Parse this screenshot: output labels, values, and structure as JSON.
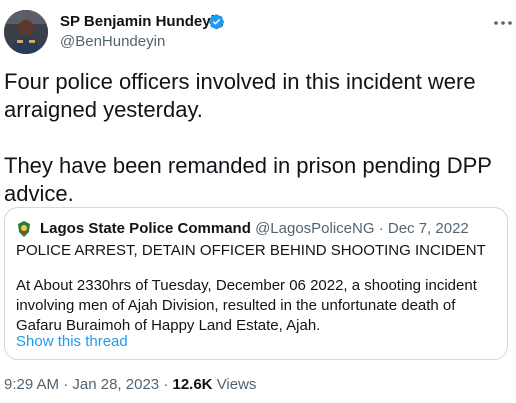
{
  "author": {
    "name": "SP Benjamin Hundeyin",
    "handle": "@BenHundeyin",
    "verified": true,
    "verified_color": "#1d9bf0"
  },
  "tweet": {
    "paragraph1": "Four police officers involved in this incident were arraigned yesterday.",
    "paragraph2": "They have been remanded in prison pending DPP advice."
  },
  "quoted": {
    "name": "Lagos State Police Command",
    "handle": "@LagosPoliceNG",
    "separator": "·",
    "date": "Dec 7, 2022",
    "title": "POLICE ARREST, DETAIN OFFICER BEHIND SHOOTING INCIDENT",
    "body": "At About 2330hrs of Tuesday, December 06 2022, a shooting incident involving men of Ajah Division, resulted in the unfortunate death of Gafaru Buraimoh of Happy Land Estate, Ajah.",
    "show_thread": "Show this thread"
  },
  "meta": {
    "time": "9:29 AM",
    "dot": "·",
    "date": "Jan 28, 2023",
    "views_count": "12.6K",
    "views_label": "Views"
  },
  "colors": {
    "text_primary": "#0f1419",
    "text_secondary": "#536471",
    "link": "#1d9bf0",
    "border": "#cfd9de"
  },
  "icons": {
    "verified": "verified-badge-icon",
    "more": "more-options-icon",
    "quoted_avatar": "police-emblem-icon"
  }
}
